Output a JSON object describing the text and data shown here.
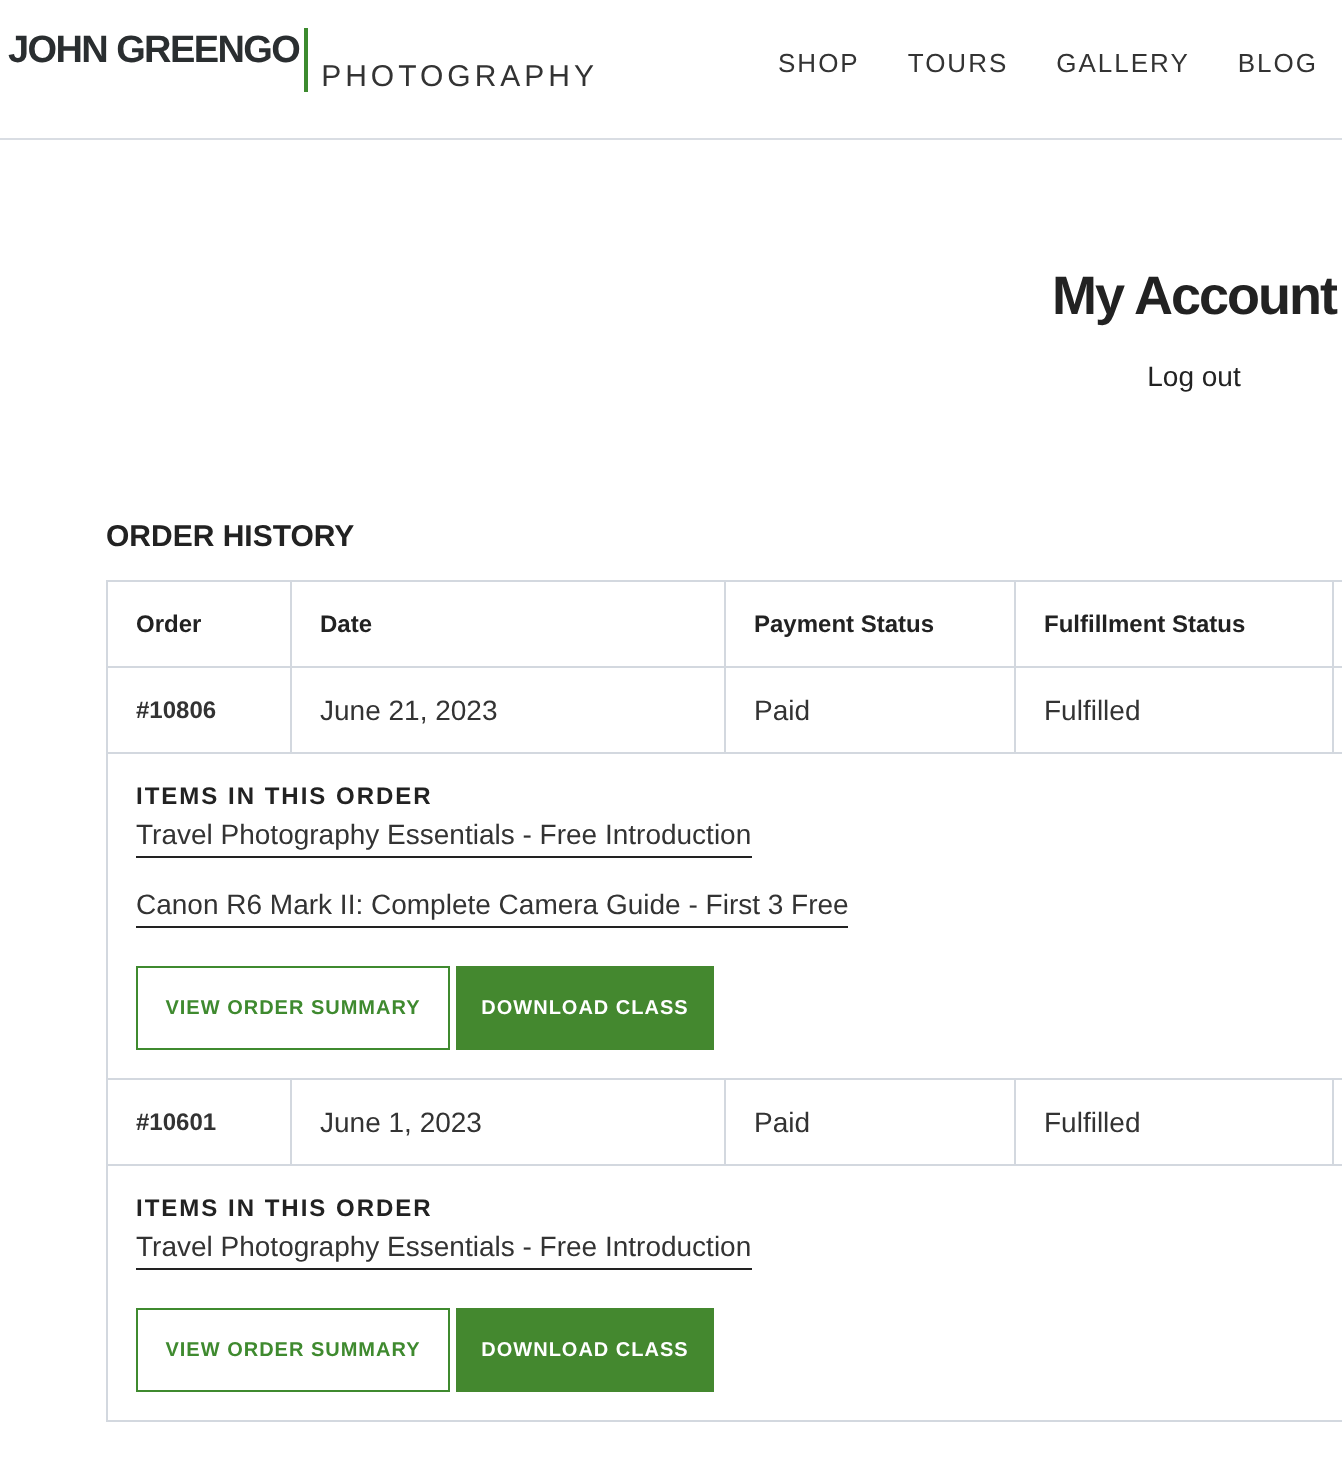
{
  "header": {
    "logo_name": "JOHN GREENGO",
    "logo_sub": "PHOTOGRAPHY",
    "nav": [
      "SHOP",
      "TOURS",
      "GALLERY",
      "BLOG"
    ]
  },
  "page": {
    "title": "My Account",
    "logout": "Log out"
  },
  "order_history": {
    "title": "ORDER HISTORY",
    "columns": [
      "Order",
      "Date",
      "Payment Status",
      "Fulfillment Status"
    ],
    "orders": [
      {
        "number": "#10806",
        "date": "June 21, 2023",
        "payment": "Paid",
        "fulfillment": "Fulfilled",
        "items_label": "ITEMS IN THIS ORDER",
        "items": [
          "Travel Photography Essentials - Free Introduction",
          "Canon R6 Mark II: Complete Camera Guide - First 3 Free"
        ],
        "buttons": [
          {
            "label": "VIEW ORDER SUMMARY",
            "kind": "outline"
          },
          {
            "label": "DOWNLOAD CLASS",
            "kind": "filled"
          }
        ]
      },
      {
        "number": "#10601",
        "date": "June 1, 2023",
        "payment": "Paid",
        "fulfillment": "Fulfilled",
        "items_label": "ITEMS IN THIS ORDER",
        "items": [
          "Travel Photography Essentials - Free Introduction"
        ],
        "buttons": [
          {
            "label": "VIEW ORDER SUMMARY",
            "kind": "outline"
          },
          {
            "label": "DOWNLOAD CLASS",
            "kind": "filled"
          }
        ]
      }
    ]
  }
}
